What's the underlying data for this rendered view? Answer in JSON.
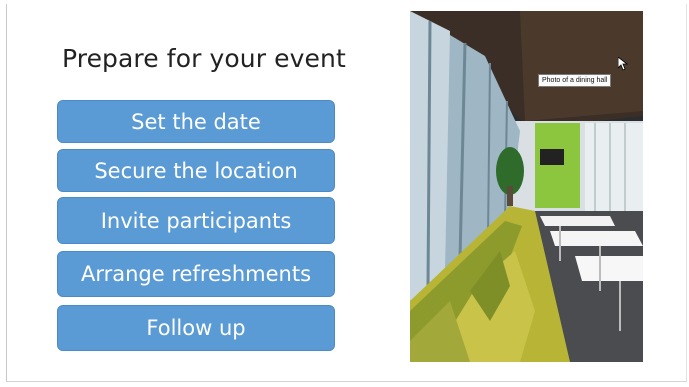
{
  "slide": {
    "title": "Prepare for your event",
    "steps": [
      {
        "label": "Set the date"
      },
      {
        "label": "Secure the location"
      },
      {
        "label": "Invite participants"
      },
      {
        "label": "Arrange refreshments"
      },
      {
        "label": "Follow up"
      }
    ],
    "image": {
      "tooltip": "Photo of a dining hall"
    }
  },
  "colors": {
    "step_fill": "#5b9bd5",
    "step_border": "#4a8ac6",
    "step_text": "#ffffff",
    "title_text": "#222222"
  }
}
